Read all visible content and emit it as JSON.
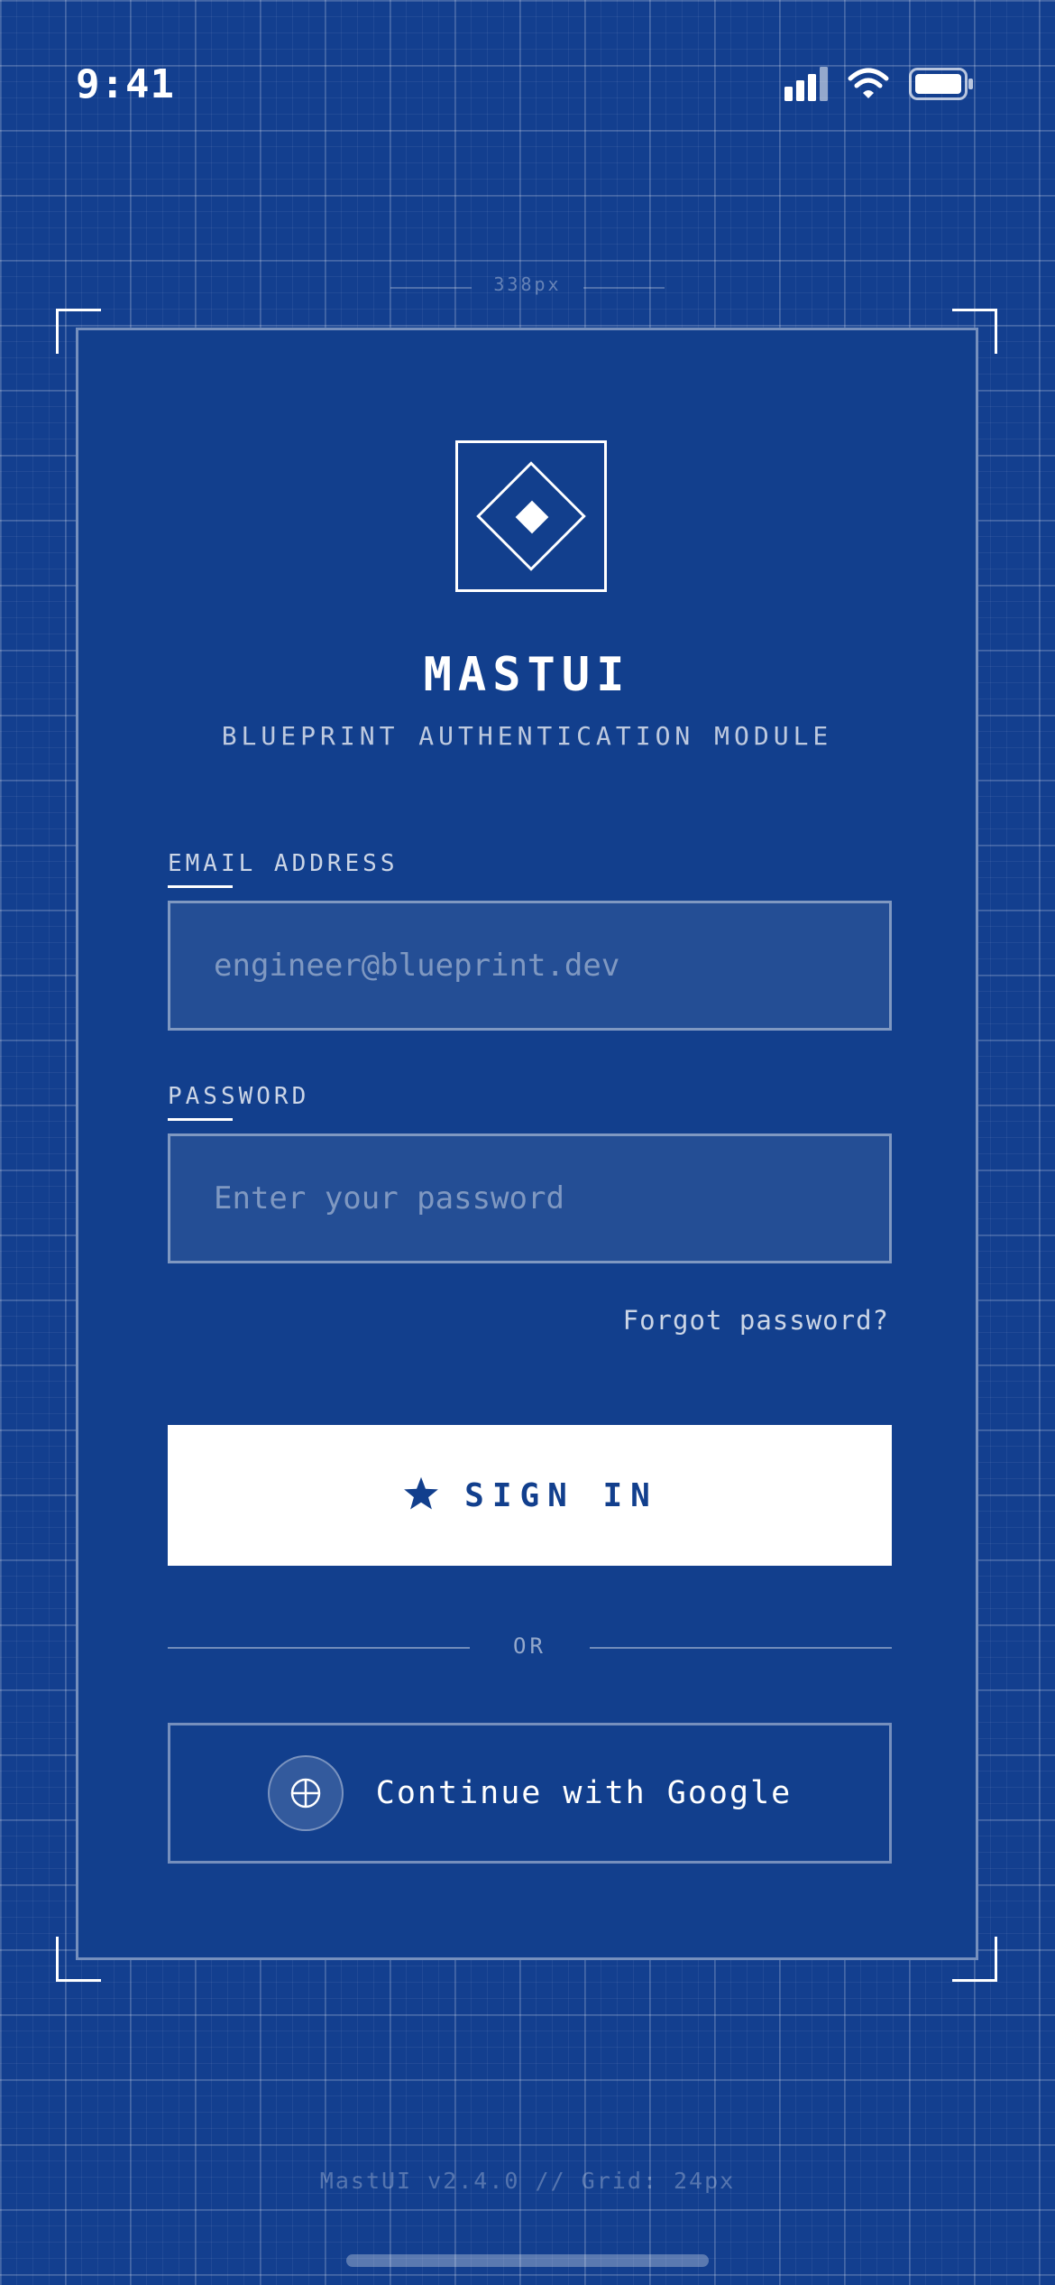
{
  "status_bar": {
    "time": "9:41",
    "icons": [
      "cellular-signal-icon",
      "wifi-icon",
      "battery-icon"
    ]
  },
  "annotation": {
    "dimension_label": "338px"
  },
  "brand": {
    "logo_icon": "diamond-logo-icon",
    "name": "MASTUI",
    "tagline": "BLUEPRINT AUTHENTICATION MODULE"
  },
  "form": {
    "email": {
      "label": "EMAIL ADDRESS",
      "placeholder": "engineer@blueprint.dev",
      "value": ""
    },
    "password": {
      "label": "PASSWORD",
      "placeholder": "Enter your password",
      "value": ""
    },
    "forgot_label": "Forgot password?",
    "sign_in_label": "SIGN IN",
    "sign_in_icon": "star-icon",
    "divider_label": "OR",
    "google_label": "Continue with Google",
    "google_icon": "globe-icon"
  },
  "footer": {
    "text": "MastUI v2.4.0 // Grid: 24px"
  },
  "colors": {
    "background": "#133f8f",
    "card": "#123f8d",
    "accent": "#ffffff",
    "button_text": "#123f8d"
  }
}
